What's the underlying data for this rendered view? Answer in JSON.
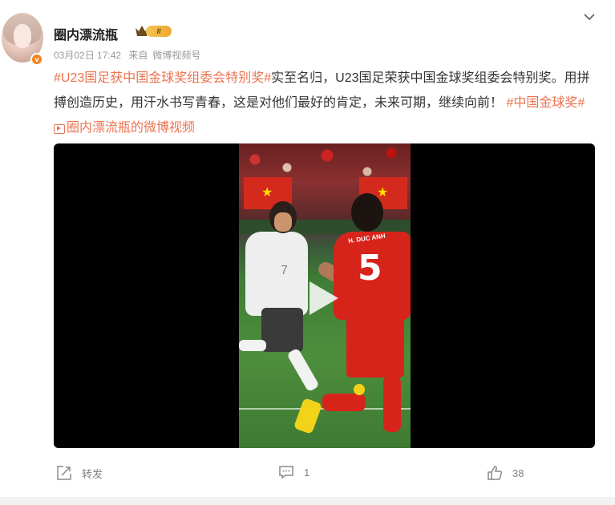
{
  "author": {
    "name": "圈内漂流瓶",
    "level_badge": "II",
    "verified_badge": "v",
    "date": "03月02日 17:42",
    "source_prefix": "来自",
    "source": "微博视频号"
  },
  "post": {
    "hashtag1": "#U23国足获中国金球奖组委会特别奖#",
    "body": "实至名归，U23国足荣获中国金球奖组委会特别奖。用拼搏创造历史，用汗水书写青春，这是对他们最好的肯定，未来可期，继续向前！",
    "hashtag2": "#中国金球奖#",
    "video_link": "圈内漂流瓶的微博视频"
  },
  "video": {
    "jersey_name": "H. DUC ANH",
    "jersey_number": "5",
    "opponent_number": "7"
  },
  "actions": {
    "repost_label": "转发",
    "comment_count": "1",
    "like_count": "38"
  },
  "colors": {
    "accent": "#eb7350",
    "badge": "#f5821f"
  }
}
